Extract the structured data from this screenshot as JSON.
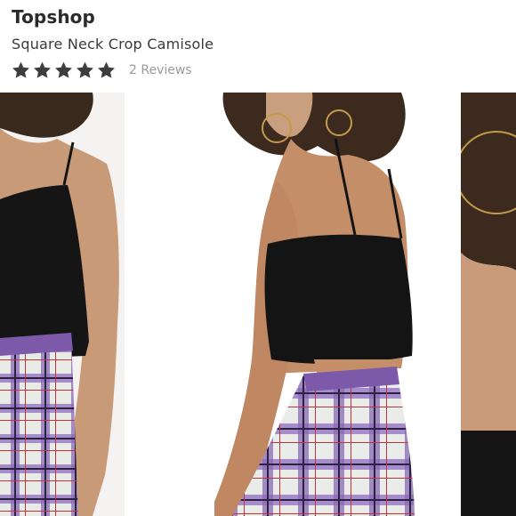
{
  "product": {
    "brand": "Topshop",
    "name": "Square Neck Crop Camisole"
  },
  "rating": {
    "stars": 5,
    "max_stars": 5,
    "reviews_label": "2 Reviews",
    "star_color": "#3d3d3d"
  },
  "gallery": {
    "images": [
      {
        "id": "left",
        "icon": "product-photo"
      },
      {
        "id": "center",
        "icon": "product-photo"
      },
      {
        "id": "right",
        "icon": "product-photo"
      }
    ]
  },
  "colors": {
    "text": "#2b2b2b",
    "muted": "#9a9a9a",
    "top": "#151515",
    "plaid_base": "#e8ebe6",
    "plaid_purple": "#8a6bb5",
    "plaid_dark": "#2a2240",
    "plaid_red": "#c0353a"
  }
}
